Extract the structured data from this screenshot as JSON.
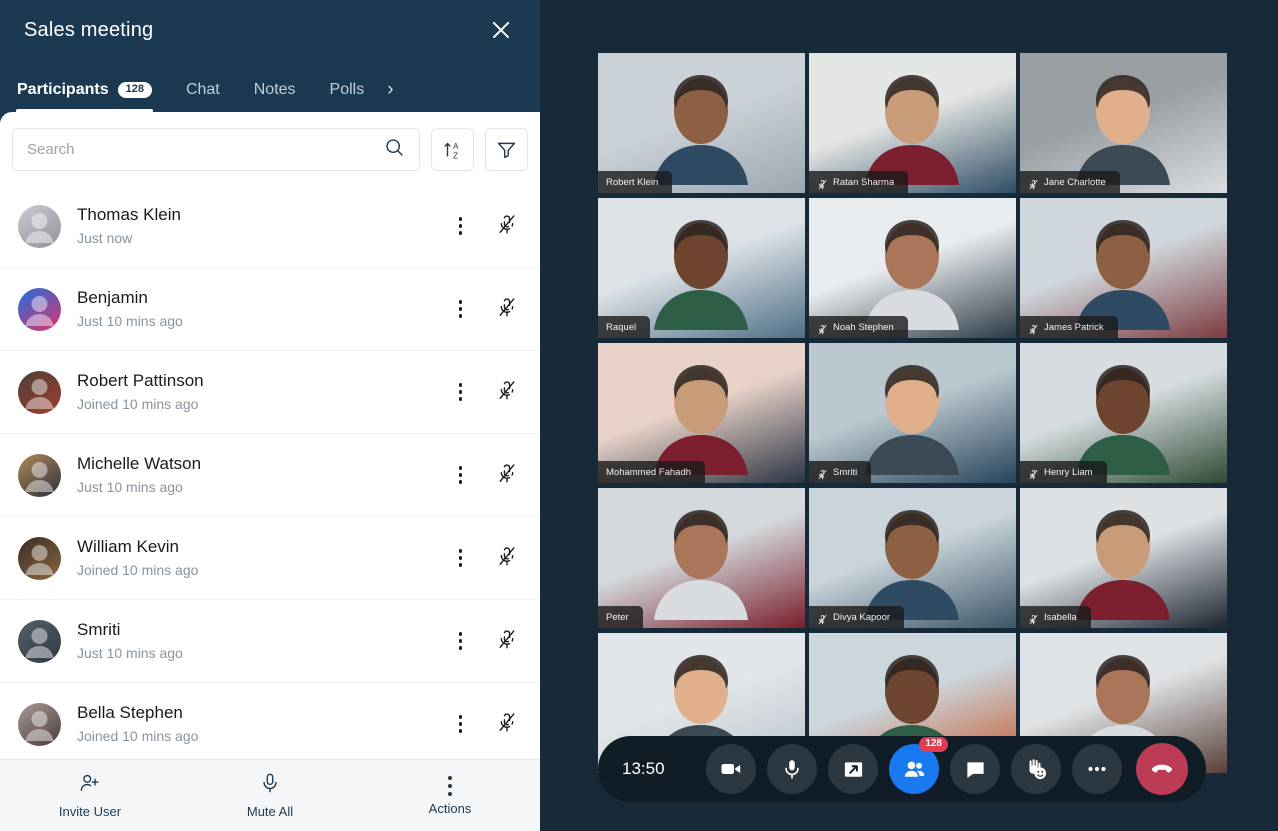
{
  "panel": {
    "title": "Sales meeting",
    "close_icon": "close-icon",
    "tabs": [
      {
        "label": "Participants",
        "badge": "128",
        "active": true
      },
      {
        "label": "Chat",
        "badge": "",
        "active": false
      },
      {
        "label": "Notes",
        "badge": "",
        "active": false
      },
      {
        "label": "Polls",
        "badge": "",
        "active": false
      }
    ],
    "tab_next_glyph": "›",
    "search": {
      "placeholder": "Search",
      "value": "",
      "icon": "search-icon"
    },
    "sort_button": {
      "icon": "sort-az-icon",
      "label": "Sort A to Z"
    },
    "filter_button": {
      "icon": "filter-funnel-icon",
      "label": "Filter"
    },
    "participants": [
      {
        "name": "Thomas Klein",
        "status": "Just now",
        "menu_icon": "more-vertical-icon",
        "mic_icon": "mic-off-icon"
      },
      {
        "name": "Benjamin",
        "status": "Just 10 mins ago",
        "menu_icon": "more-vertical-icon",
        "mic_icon": "mic-off-icon"
      },
      {
        "name": "Robert Pattinson",
        "status": "Joined 10 mins ago",
        "menu_icon": "more-vertical-icon",
        "mic_icon": "mic-off-icon"
      },
      {
        "name": "Michelle Watson",
        "status": "Just 10 mins ago",
        "menu_icon": "more-vertical-icon",
        "mic_icon": "mic-off-icon"
      },
      {
        "name": "William Kevin",
        "status": "Joined 10 mins ago",
        "menu_icon": "more-vertical-icon",
        "mic_icon": "mic-off-icon"
      },
      {
        "name": "Smriti",
        "status": "Just 10 mins ago",
        "menu_icon": "more-vertical-icon",
        "mic_icon": "mic-off-icon"
      },
      {
        "name": "Bella Stephen",
        "status": "Joined 10 mins ago",
        "menu_icon": "more-vertical-icon",
        "mic_icon": "mic-off-icon"
      }
    ],
    "footer": [
      {
        "label": "Invite User",
        "icon": "add-user-icon"
      },
      {
        "label": "Mute All",
        "icon": "microphone-icon"
      },
      {
        "label": "Actions",
        "icon": "more-vertical-icon"
      }
    ]
  },
  "stage": {
    "tiles": [
      {
        "name": "Robert Klein",
        "muted": false
      },
      {
        "name": "Ratan Sharma",
        "muted": true
      },
      {
        "name": "Jane Charlotte",
        "muted": true
      },
      {
        "name": "Raquel",
        "muted": false
      },
      {
        "name": "Noah Stephen",
        "muted": true
      },
      {
        "name": "James Patrick",
        "muted": true
      },
      {
        "name": "Mohammed Fahadh",
        "muted": false
      },
      {
        "name": "Smriti",
        "muted": true
      },
      {
        "name": "Henry Liam",
        "muted": true
      },
      {
        "name": "Peter",
        "muted": false
      },
      {
        "name": "Divya Kapoor",
        "muted": true
      },
      {
        "name": "Isabella",
        "muted": true
      },
      {
        "name": "",
        "muted": false
      },
      {
        "name": "",
        "muted": false
      },
      {
        "name": "",
        "muted": false
      }
    ],
    "controls": {
      "time": "13:50",
      "buttons": [
        {
          "name": "camera-button",
          "icon": "video-camera-icon",
          "badge": ""
        },
        {
          "name": "microphone-button",
          "icon": "microphone-icon",
          "badge": ""
        },
        {
          "name": "share-screen-button",
          "icon": "share-screen-icon",
          "badge": ""
        },
        {
          "name": "participants-button",
          "icon": "people-icon",
          "badge": "128"
        },
        {
          "name": "chat-button",
          "icon": "chat-bubble-icon",
          "badge": ""
        },
        {
          "name": "reactions-button",
          "icon": "raise-hand-smiley-icon",
          "badge": ""
        },
        {
          "name": "more-options-button",
          "icon": "more-horizontal-icon",
          "badge": ""
        },
        {
          "name": "end-call-button",
          "icon": "phone-hangup-icon",
          "badge": ""
        }
      ]
    }
  },
  "colors": {
    "panel_navy": "#1B3A52",
    "stage_navy": "#172A39",
    "accent_blue": "#1879F0",
    "danger_red": "#BD3C55",
    "badge_red": "#E03B4F"
  }
}
